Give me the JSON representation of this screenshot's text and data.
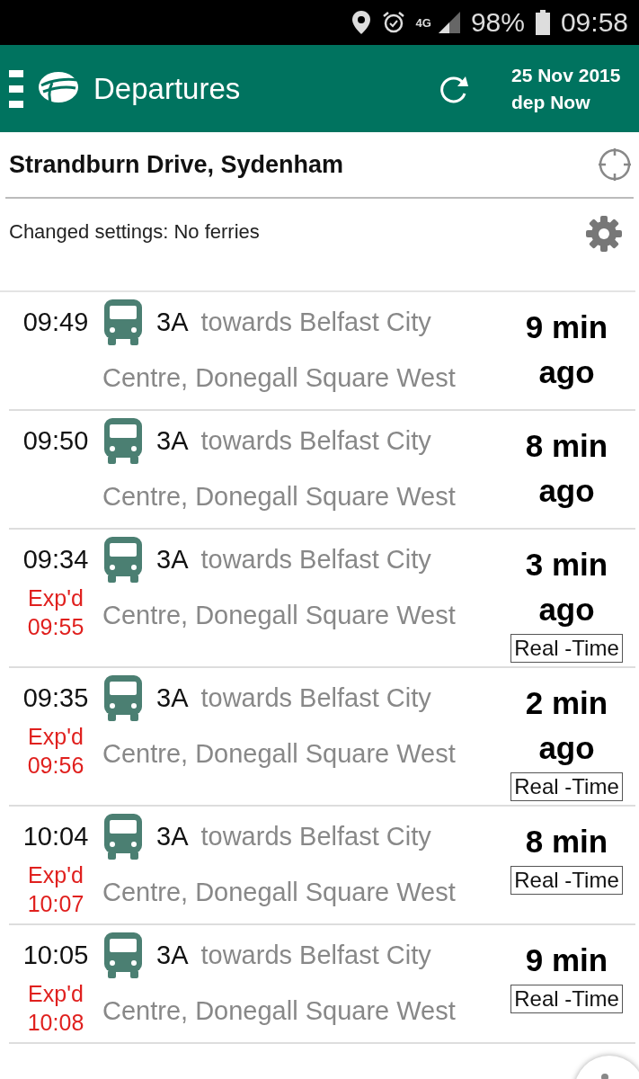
{
  "status_bar": {
    "network": "4G",
    "battery": "98%",
    "time": "09:58"
  },
  "header": {
    "title": "Departures",
    "date": "25 Nov 2015",
    "dep": "dep Now"
  },
  "location": {
    "value": "Strandburn Drive, Sydenham"
  },
  "settings_note": "Changed settings: No ferries",
  "departures": [
    {
      "time": "09:49",
      "route": "3A",
      "destination": [
        "towards Belfast City",
        "Centre, Donegall Square West"
      ],
      "due": "9 min ago",
      "real_time": false
    },
    {
      "time": "09:50",
      "route": "3A",
      "destination": [
        "towards Belfast City",
        "Centre, Donegall Square West"
      ],
      "due": "8 min ago",
      "real_time": false
    },
    {
      "time": "09:34",
      "expected": "Exp'd 09:55",
      "route": "3A",
      "destination": [
        "towards Belfast City",
        "Centre, Donegall Square West"
      ],
      "due": "3 min ago",
      "real_time": true,
      "badge": "Real -Time"
    },
    {
      "time": "09:35",
      "expected": "Exp'd 09:56",
      "route": "3A",
      "destination": [
        "towards Belfast City",
        "Centre, Donegall Square West"
      ],
      "due": "2 min ago",
      "real_time": true,
      "badge": "Real -Time"
    },
    {
      "time": "10:04",
      "expected": "Exp'd 10:07",
      "route": "3A",
      "destination": [
        "towards Belfast City",
        "Centre, Donegall Square West"
      ],
      "due": "8 min",
      "real_time": true,
      "badge": "Real -Time"
    },
    {
      "time": "10:05",
      "expected": "Exp'd 10:08",
      "route": "3A",
      "destination": [
        "towards Belfast City",
        "Centre, Donegall Square West"
      ],
      "due": "9 min",
      "real_time": true,
      "badge": "Real -Time"
    }
  ]
}
